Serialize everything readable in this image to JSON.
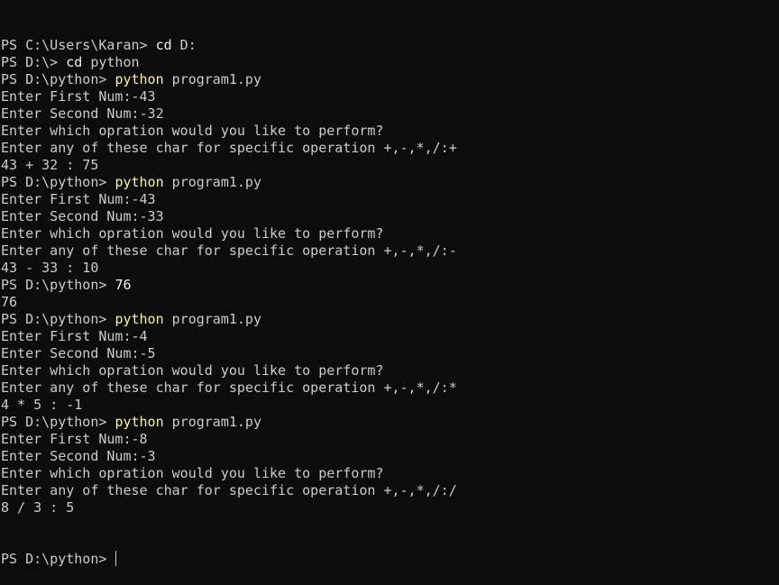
{
  "terminal": {
    "lines": [
      {
        "prompt": "PS C:\\Users\\Karan> ",
        "cmd": "cd",
        "cmd_color": "white",
        "args": " D:"
      },
      {
        "prompt": "PS D:\\> ",
        "cmd": "cd",
        "cmd_color": "white",
        "args": " python"
      },
      {
        "prompt": "PS D:\\python> ",
        "cmd": "python",
        "cmd_color": "yellow",
        "args": " program1.py"
      },
      {
        "text": "Enter First Num:-43"
      },
      {
        "text": "Enter Second Num:-32"
      },
      {
        "text": "Enter which opration would you like to perform?"
      },
      {
        "text": "Enter any of these char for specific operation +,-,*,/:+"
      },
      {
        "text": "43 + 32 : 75"
      },
      {
        "prompt": "PS D:\\python> ",
        "cmd": "python",
        "cmd_color": "yellow",
        "args": " program1.py"
      },
      {
        "text": "Enter First Num:-43"
      },
      {
        "text": "Enter Second Num:-33"
      },
      {
        "text": "Enter which opration would you like to perform?"
      },
      {
        "text": "Enter any of these char for specific operation +,-,*,/:-"
      },
      {
        "text": "43 - 33 : 10"
      },
      {
        "prompt": "PS D:\\python> ",
        "cmd": "76",
        "cmd_color": "white",
        "args": ""
      },
      {
        "text": "76"
      },
      {
        "prompt": "PS D:\\python> ",
        "cmd": "python",
        "cmd_color": "yellow",
        "args": " program1.py"
      },
      {
        "text": "Enter First Num:-4"
      },
      {
        "text": "Enter Second Num:-5"
      },
      {
        "text": "Enter which opration would you like to perform?"
      },
      {
        "text": "Enter any of these char for specific operation +,-,*,/:*"
      },
      {
        "text": "4 * 5 : -1"
      },
      {
        "prompt": "PS D:\\python> ",
        "cmd": "python",
        "cmd_color": "yellow",
        "args": " program1.py"
      },
      {
        "text": "Enter First Num:-8"
      },
      {
        "text": "Enter Second Num:-3"
      },
      {
        "text": "Enter which opration would you like to perform?"
      },
      {
        "text": "Enter any of these char for specific operation +,-,*,/:/"
      },
      {
        "text": "8 / 3 : 5"
      }
    ],
    "current_prompt": "PS D:\\python> "
  },
  "colors": {
    "background": "#0c0c0c",
    "foreground": "#cccccc",
    "command_yellow": "#f9f1a5",
    "command_white": "#f2f2f2"
  }
}
